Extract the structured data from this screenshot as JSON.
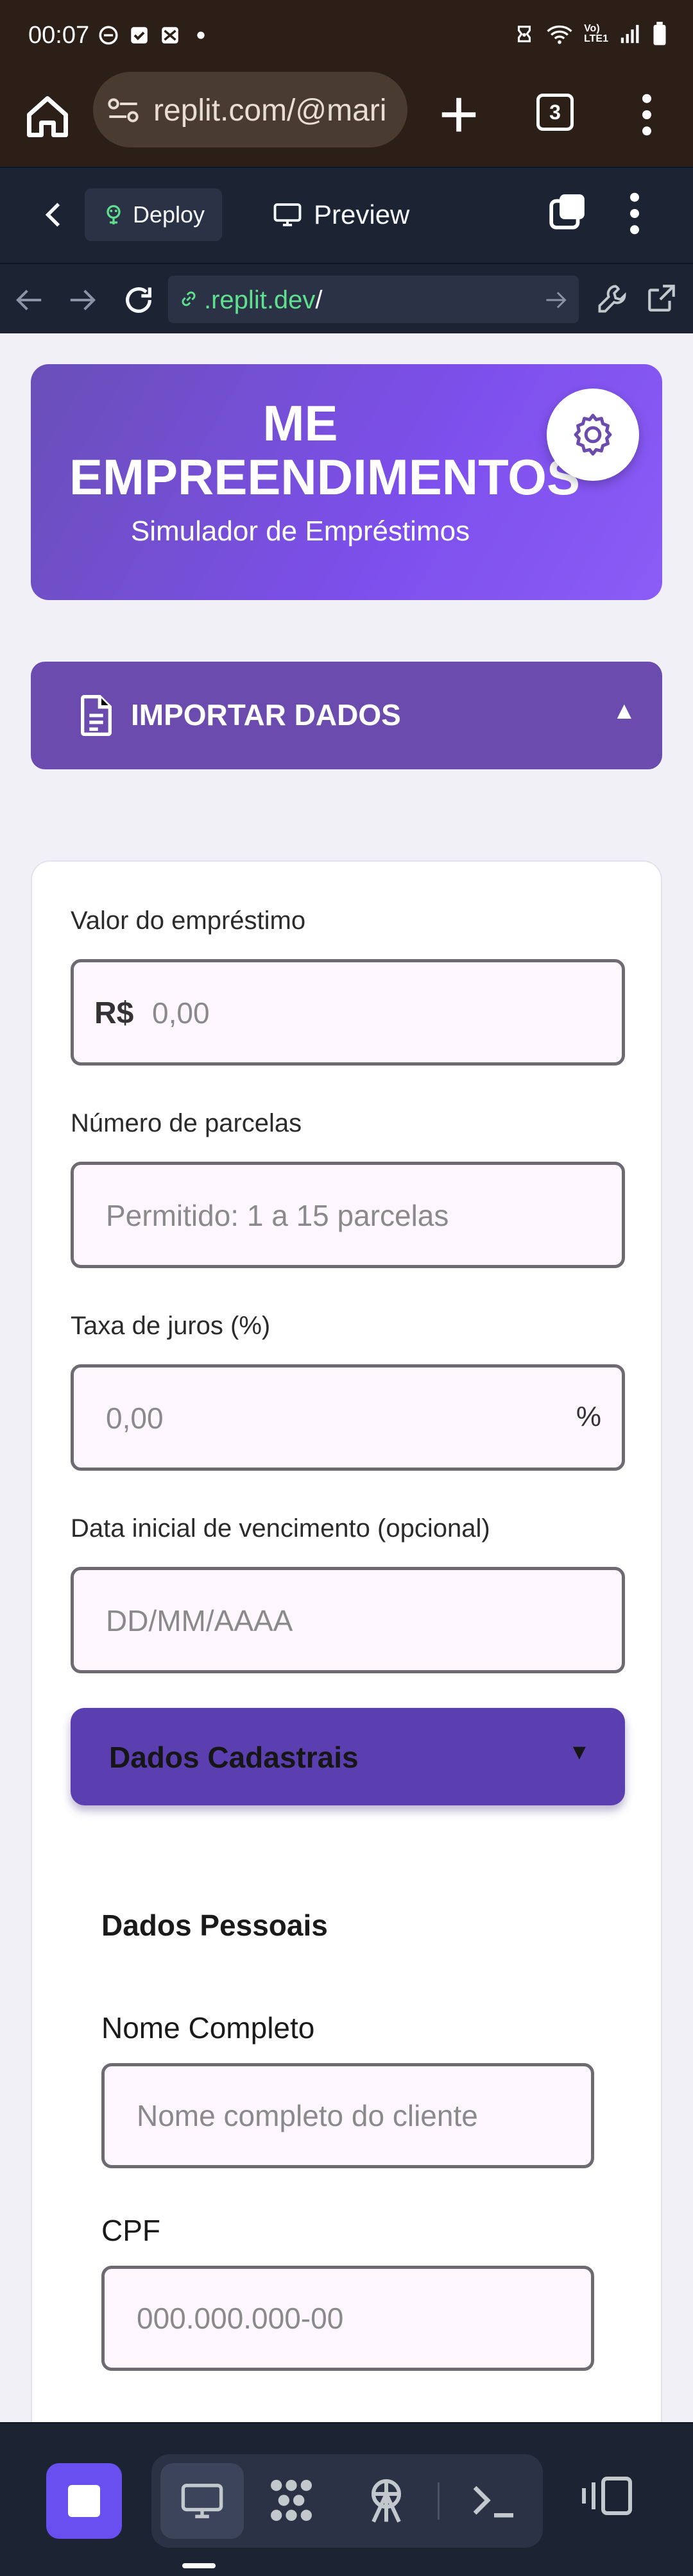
{
  "status_bar": {
    "time": "00:07"
  },
  "browser": {
    "url": "replit.com/@mari",
    "tab_count": "3"
  },
  "replit": {
    "deploy_label": "Deploy",
    "preview_label": "Preview"
  },
  "webview": {
    "url_domain": ".replit.dev",
    "url_path": "/"
  },
  "hero": {
    "title": "ME EMPREENDIMENTOS",
    "subtitle": "Simulador de Empréstimos"
  },
  "import": {
    "label": "IMPORTAR DADOS",
    "caret": "▲"
  },
  "form": {
    "loan_amount": {
      "label": "Valor do empréstimo",
      "prefix": "R$",
      "placeholder": "0,00"
    },
    "installments": {
      "label": "Número de parcelas",
      "placeholder": "Permitido: 1 a 15 parcelas"
    },
    "interest": {
      "label": "Taxa de juros (%)",
      "placeholder": "0,00",
      "suffix": "%"
    },
    "due_date": {
      "label": "Data inicial de vencimento (opcional)",
      "placeholder": "DD/MM/AAAA"
    },
    "registration": {
      "label": "Dados Cadastrais",
      "caret": "▼"
    },
    "personal": {
      "title": "Dados Pessoais",
      "full_name": {
        "label": "Nome Completo",
        "placeholder": "Nome completo do cliente"
      },
      "cpf": {
        "label": "CPF",
        "placeholder": "000.000.000-00"
      }
    }
  },
  "colors": {
    "accent": "#7d4fec",
    "import_bg": "#6b4cae",
    "replit_bg": "#1c2333",
    "url_green": "#5ee08f"
  }
}
